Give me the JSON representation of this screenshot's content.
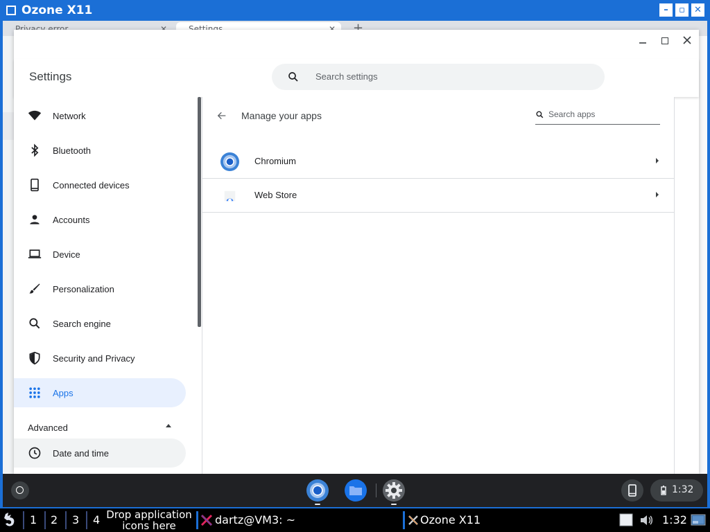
{
  "x11_window": {
    "title": "Ozone X11",
    "controls": [
      "minimize",
      "maximize",
      "close"
    ]
  },
  "background_browser": {
    "tabs": [
      {
        "label": "Privacy error"
      },
      {
        "label": "Settings"
      }
    ]
  },
  "settings_window": {
    "header_title": "Settings",
    "search_placeholder": "Search settings"
  },
  "sidebar": {
    "items": [
      {
        "label": "Network",
        "icon": "wifi-icon"
      },
      {
        "label": "Bluetooth",
        "icon": "bluetooth-icon"
      },
      {
        "label": "Connected devices",
        "icon": "phone-icon"
      },
      {
        "label": "Accounts",
        "icon": "person-icon"
      },
      {
        "label": "Device",
        "icon": "laptop-icon"
      },
      {
        "label": "Personalization",
        "icon": "brush-icon"
      },
      {
        "label": "Search engine",
        "icon": "search-icon"
      },
      {
        "label": "Security and Privacy",
        "icon": "shield-icon"
      },
      {
        "label": "Apps",
        "icon": "apps-grid-icon",
        "active": true
      }
    ],
    "advanced_label": "Advanced",
    "advanced_items": [
      {
        "label": "Date and time",
        "icon": "clock-icon"
      }
    ]
  },
  "main": {
    "title": "Manage your apps",
    "search_placeholder": "Search apps",
    "apps": [
      {
        "name": "Chromium",
        "icon": "chromium-icon"
      },
      {
        "name": "Web Store",
        "icon": "web-store-icon"
      }
    ]
  },
  "shelf": {
    "apps": [
      "chromium-icon",
      "files-icon",
      "settings-gear-icon"
    ],
    "time": "1:32"
  },
  "x11_panel": {
    "workspaces": [
      "1",
      "2",
      "3",
      "4"
    ],
    "drop_text_line1": "Drop application",
    "drop_text_line2": "icons here",
    "tasks": [
      {
        "label": "dartz@VM3: ~"
      },
      {
        "label": "Ozone X11"
      }
    ],
    "clock": "1:32"
  },
  "colors": {
    "x11_blue": "#1b6fd6",
    "accent": "#1a73e8",
    "active_bg": "#e8f0fe",
    "shelf_bg": "#202124"
  }
}
